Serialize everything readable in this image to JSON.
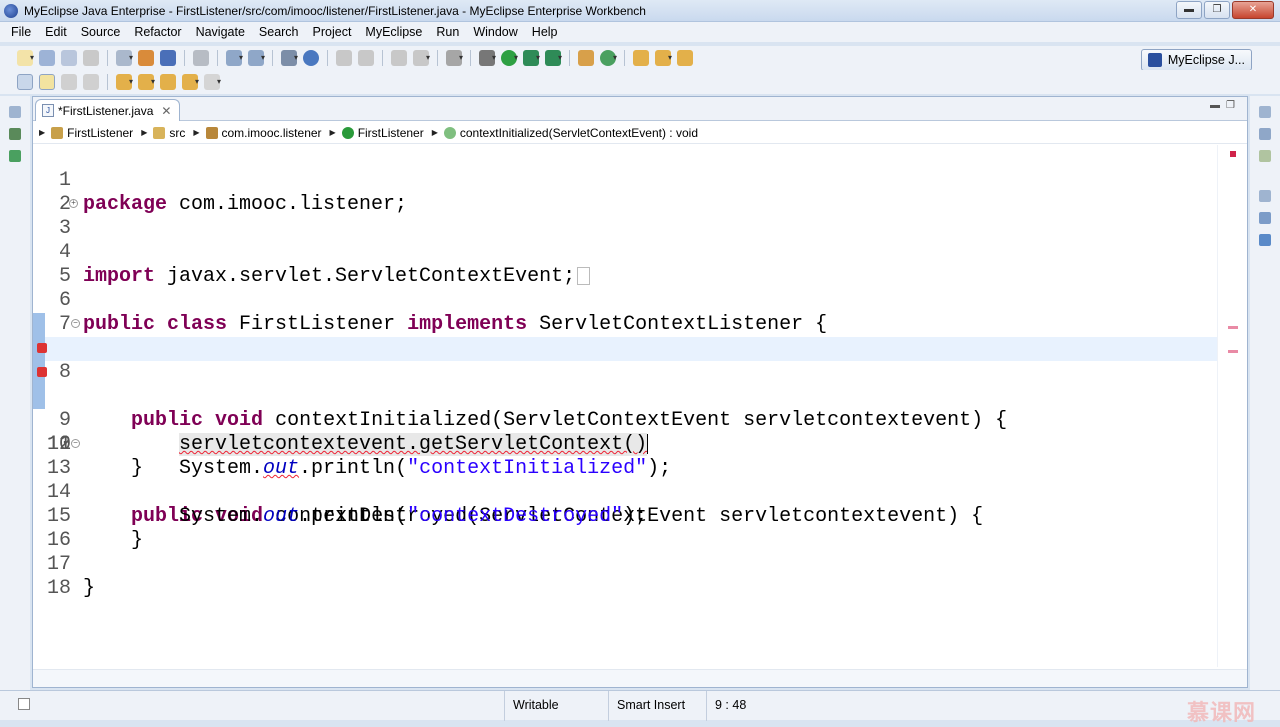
{
  "window": {
    "title": "MyEclipse Java Enterprise - FirstListener/src/com/imooc/listener/FirstListener.java - MyEclipse Enterprise Workbench",
    "minimize": "▬",
    "maximize": "❐",
    "close": "✕"
  },
  "menu": [
    "File",
    "Edit",
    "Source",
    "Refactor",
    "Navigate",
    "Search",
    "Project",
    "MyEclipse",
    "Run",
    "Window",
    "Help"
  ],
  "perspective": {
    "label": "MyEclipse J..."
  },
  "editor": {
    "tab_label": "*FirstListener.java",
    "breadcrumb": [
      "FirstListener",
      "src",
      "com.imooc.listener",
      "FirstListener",
      "contextInitialized(ServletContextEvent) : void"
    ],
    "lines": [
      {
        "n": "1"
      },
      {
        "n": "2"
      },
      {
        "n": "3"
      },
      {
        "n": "4"
      },
      {
        "n": "5"
      },
      {
        "n": "6"
      },
      {
        "n": "7"
      },
      {
        "n": "8"
      },
      {
        "n": "9"
      },
      {
        "n": "10"
      },
      {
        "n": "11"
      },
      {
        "n": "12"
      },
      {
        "n": "13"
      },
      {
        "n": "14"
      },
      {
        "n": "15"
      },
      {
        "n": "16"
      },
      {
        "n": "17"
      },
      {
        "n": "18"
      }
    ],
    "code": {
      "l1_kw": "package",
      "l1_rest": " com.imooc.listener;",
      "l3_kw": "import",
      "l3_rest": " javax.servlet.ServletContextEvent;",
      "l6_kw1": "public",
      "l6_kw2": "class",
      "l6_name": " FirstListener ",
      "l6_kw3": "implements",
      "l6_rest": " ServletContextListener {",
      "l8_kw1": "public",
      "l8_kw2": "void",
      "l8_rest": " contextInitialized(ServletContextEvent servletcontextevent) {",
      "l9_text": "servletcontextevent.getServletContext()",
      "l10_sys": "System.",
      "l10_out": "out",
      "l10_mid": ".println(",
      "l10_str": "\"contextInitialized\"",
      "l10_end": ");",
      "l11": "}",
      "l13_kw1": "public",
      "l13_kw2": "void",
      "l13_rest": " contextDestroyed(ServletContextEvent servletcontextevent) {",
      "l14_sys": "System.",
      "l14_out": "out",
      "l14_mid": ".println(",
      "l14_str": "\"contextDestroyed\"",
      "l14_end": ");",
      "l15": "}",
      "l17": "}"
    }
  },
  "status": {
    "writable": "Writable",
    "insert_mode": "Smart Insert",
    "position": "9 : 48"
  },
  "watermark": "慕课网",
  "colors": {
    "keyword": "#7f0055",
    "string": "#2a00ff",
    "field": "#0000c0",
    "current_line": "#e8f2fe"
  }
}
